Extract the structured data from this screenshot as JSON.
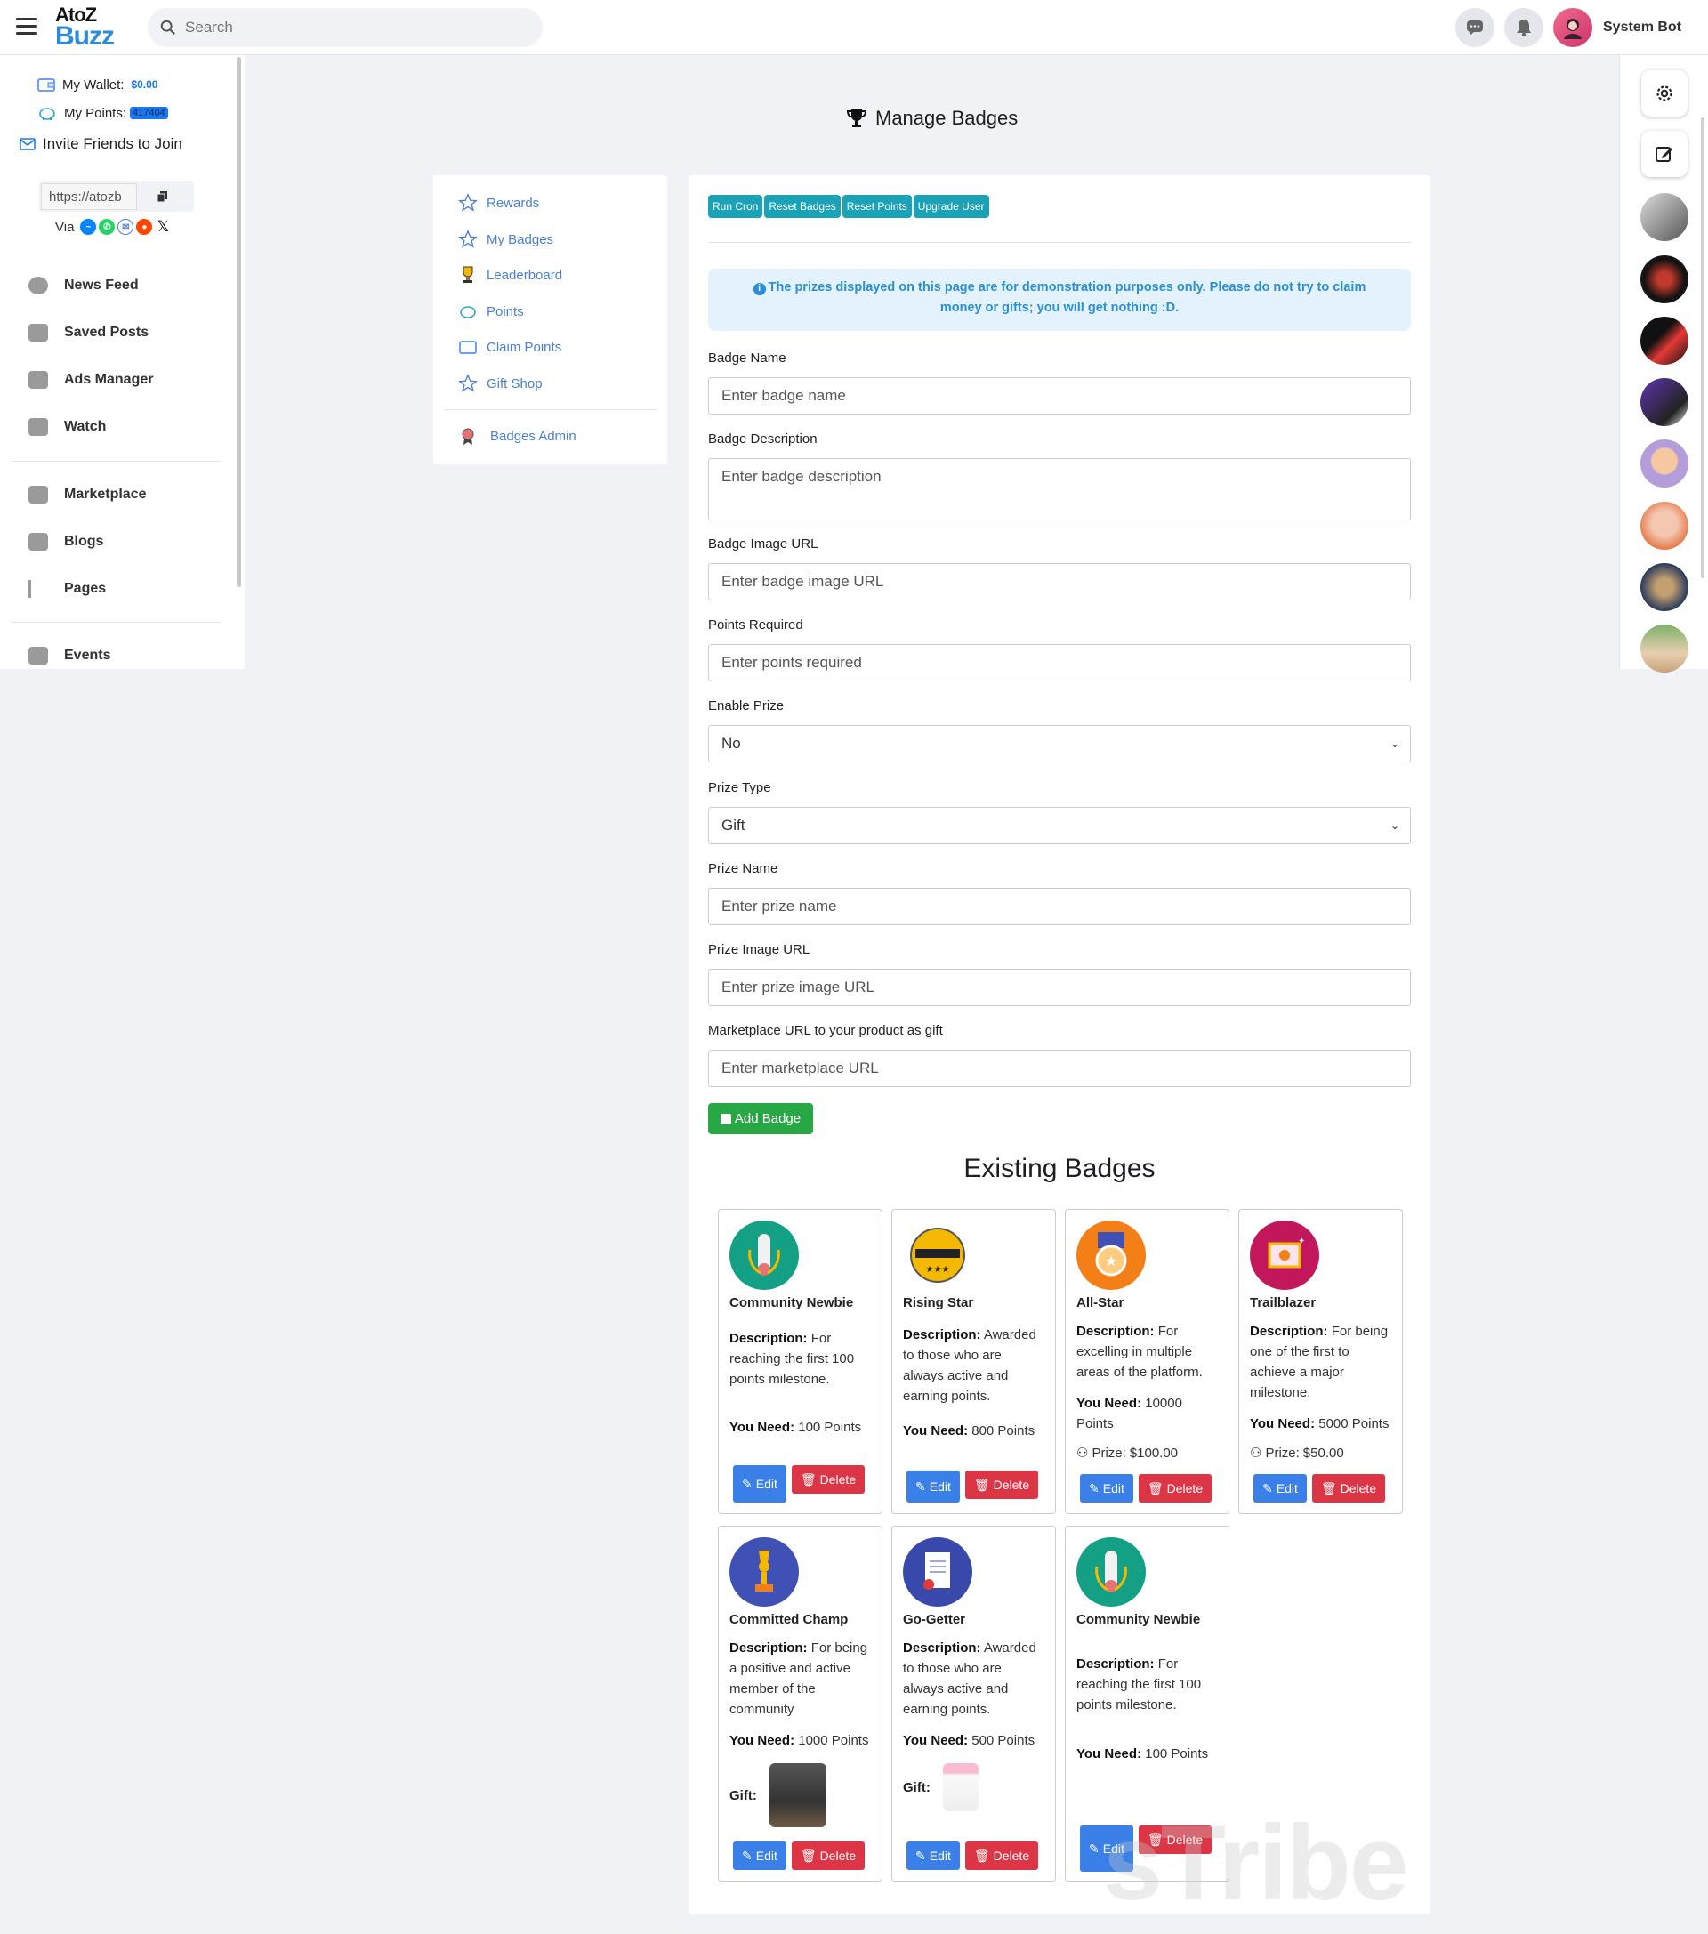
{
  "header": {
    "logo_top": "AtoZ",
    "logo_bottom": "Buzz",
    "search_placeholder": "Search",
    "user_name": "System Bot"
  },
  "sidebar": {
    "wallet_label": "My Wallet:",
    "wallet_value": "$0.00",
    "points_label": "My Points:",
    "points_value": "417404",
    "invite_label": "Invite Friends to Join",
    "ref_link": "https://atozb",
    "via_label": "Via",
    "nav": [
      {
        "label": "News Feed",
        "icon": "news-feed-icon"
      },
      {
        "label": "Saved Posts",
        "icon": "saved-posts-icon"
      },
      {
        "label": "Ads Manager",
        "icon": "ads-manager-icon"
      },
      {
        "label": "Watch",
        "icon": "watch-icon"
      },
      {
        "label": "Marketplace",
        "icon": "marketplace-icon"
      },
      {
        "label": "Blogs",
        "icon": "blogs-icon"
      },
      {
        "label": "Pages",
        "icon": "pages-icon"
      },
      {
        "label": "Events",
        "icon": "events-icon"
      }
    ]
  },
  "page": {
    "title": "Manage Badges"
  },
  "menu": {
    "items": [
      {
        "label": "Rewards",
        "icon": "star-icon"
      },
      {
        "label": "My Badges",
        "icon": "star-icon"
      },
      {
        "label": "Leaderboard",
        "icon": "trophy-icon"
      },
      {
        "label": "Points",
        "icon": "piggy-bank-icon"
      },
      {
        "label": "Claim Points",
        "icon": "wallet-icon"
      },
      {
        "label": "Gift Shop",
        "icon": "star-icon"
      }
    ],
    "admin_label": "Badges Admin"
  },
  "toolbar": {
    "run_cron": "Run Cron",
    "reset_badges": "Reset Badges",
    "reset_points": "Reset Points",
    "upgrade_user": "Upgrade User"
  },
  "alert": {
    "text": "The prizes displayed on this page are for demonstration purposes only. Please do not try to claim money or gifts; you will get nothing :D."
  },
  "form": {
    "badge_name_label": "Badge Name",
    "badge_name_placeholder": "Enter badge name",
    "badge_desc_label": "Badge Description",
    "badge_desc_placeholder": "Enter badge description",
    "badge_image_label": "Badge Image URL",
    "badge_image_placeholder": "Enter badge image URL",
    "points_label": "Points Required",
    "points_placeholder": "Enter points required",
    "enable_prize_label": "Enable Prize",
    "enable_prize_value": "No",
    "prize_type_label": "Prize Type",
    "prize_type_value": "Gift",
    "prize_name_label": "Prize Name",
    "prize_name_placeholder": "Enter prize name",
    "prize_image_label": "Prize Image URL",
    "prize_image_placeholder": "Enter prize image URL",
    "marketplace_label": "Marketplace URL to your product as gift",
    "marketplace_placeholder": "Enter marketplace URL",
    "add_button": "Add Badge"
  },
  "existing": {
    "title": "Existing Badges",
    "desc_label": "Description:",
    "need_label": "You Need:",
    "prize_label": "Prize:",
    "gift_label": "Gift:",
    "edit_label": "Edit",
    "delete_label": "Delete",
    "badges": [
      {
        "name": "Community Newbie",
        "desc": "For reaching the first 100 points milestone.",
        "need": "100 Points",
        "color": "#14a085"
      },
      {
        "name": "Rising Star",
        "desc": "Awarded to those who are always active and earning points.",
        "need": "800 Points",
        "color": "#f5b800"
      },
      {
        "name": "All-Star",
        "desc": "For excelling in multiple areas of the platform.",
        "need": "10000 Points",
        "prize": "$100.00",
        "color": "#f57f17"
      },
      {
        "name": "Trailblazer",
        "desc": "For being one of the first to achieve a major milestone.",
        "need": "5000 Points",
        "prize": "$50.00",
        "color": "#c2185b"
      },
      {
        "name": "Committed Champ",
        "desc": "For being a positive and active member of the community",
        "need": "1000 Points",
        "gift": true,
        "color": "#3f51b5"
      },
      {
        "name": "Go-Getter",
        "desc": "Awarded to those who are always active and earning points.",
        "need": "500 Points",
        "gift": true,
        "color": "#3949ab"
      },
      {
        "name": "Community Newbie",
        "desc": "For reaching the first 100 points milestone.",
        "need": "100 Points",
        "color": "#14a085"
      }
    ]
  },
  "watermark": "sTribe"
}
